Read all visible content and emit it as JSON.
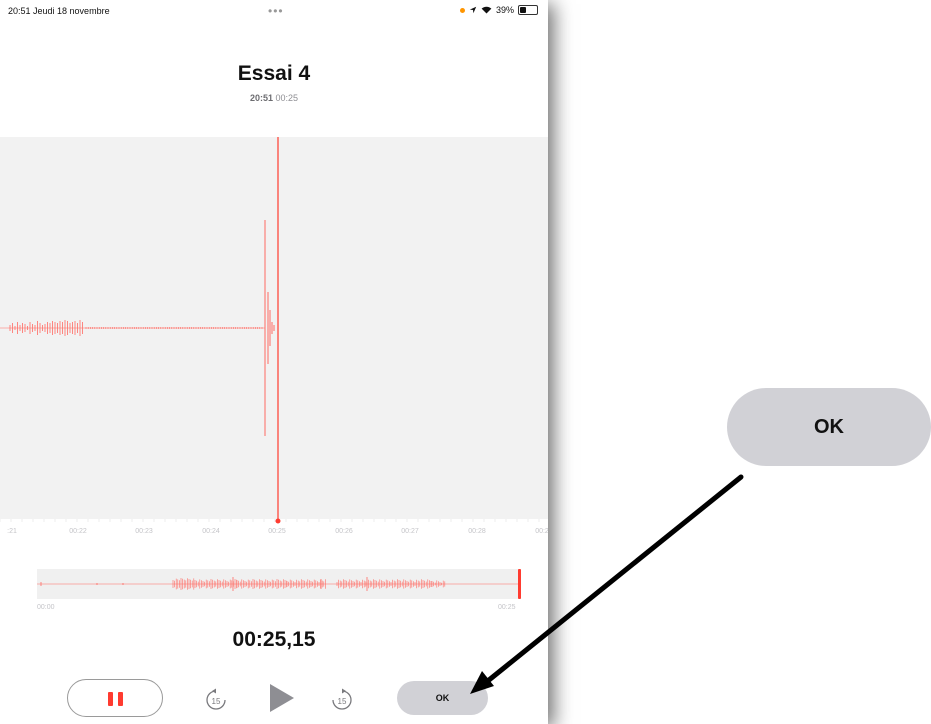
{
  "status_bar": {
    "time_date": "20:51  Jeudi 18 novembre",
    "dots": "•••",
    "battery": "39%"
  },
  "recording": {
    "title": "Essai 4",
    "time": "20:51",
    "duration": "00:25"
  },
  "timeline": {
    "labels": [
      ":21",
      "00:22",
      "00:23",
      "00:24",
      "00:25",
      "00:26",
      "00:27",
      "00:28",
      "00:2"
    ]
  },
  "overview": {
    "start": "00:00",
    "end": "00:25"
  },
  "elapsed": "00:25,15",
  "controls": {
    "skip_back": "15",
    "skip_forward": "15",
    "ok_label": "OK"
  },
  "callout": {
    "ok_label": "OK"
  },
  "colors": {
    "accent": "#ff3b30",
    "waveform": "#ff6b63",
    "button_gray": "#d1d1d6"
  }
}
